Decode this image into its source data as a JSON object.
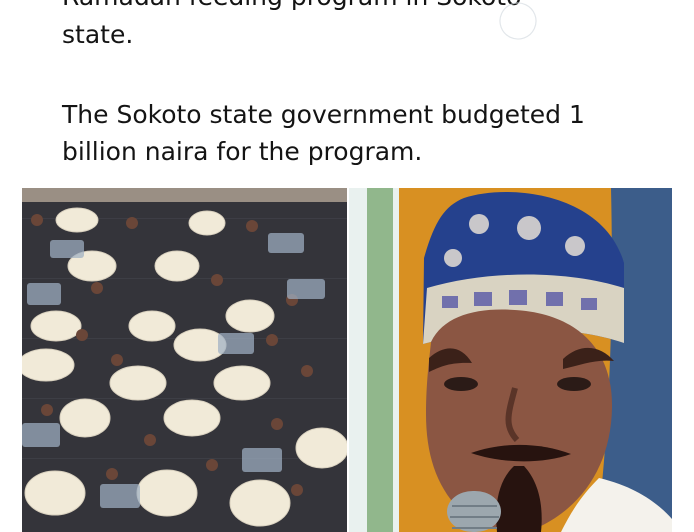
{
  "post": {
    "clipped_top_line": "Ramadan feeding program in Sokoto",
    "line_two": "state.",
    "paragraph": "The Sokoto state government budgeted 1 billion naira for the program."
  },
  "media": {
    "left_image": "bags-on-ground",
    "right_image": "portrait-with-cap"
  },
  "colors": {
    "text": "#141414",
    "ground": "#34343a",
    "rightBackground": "#d89022"
  }
}
